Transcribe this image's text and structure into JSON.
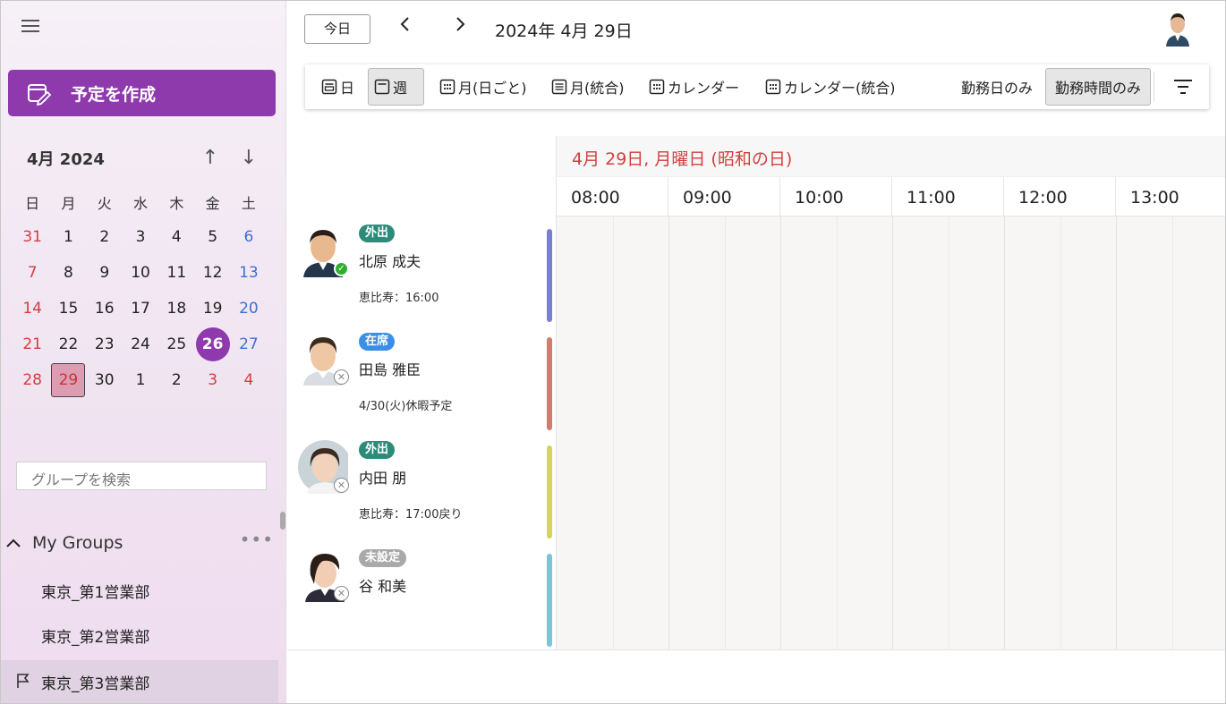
{
  "sidebar": {
    "create_label": "予定を作成",
    "mini_calendar": {
      "month_label": "4月 2024",
      "weekdays": [
        "日",
        "月",
        "火",
        "水",
        "木",
        "金",
        "土"
      ],
      "weeks": [
        [
          "31",
          "1",
          "2",
          "3",
          "4",
          "5",
          "6"
        ],
        [
          "7",
          "8",
          "9",
          "10",
          "11",
          "12",
          "13"
        ],
        [
          "14",
          "15",
          "16",
          "17",
          "18",
          "19",
          "20"
        ],
        [
          "21",
          "22",
          "23",
          "24",
          "25",
          "26",
          "27"
        ],
        [
          "28",
          "29",
          "30",
          "1",
          "2",
          "3",
          "4"
        ]
      ],
      "selected_day": "26",
      "today_day": "29"
    },
    "group_search_placeholder": "グループを検索",
    "my_groups_label": "My Groups",
    "groups": [
      {
        "label": "東京_第1営業部",
        "active": false
      },
      {
        "label": "東京_第2営業部",
        "active": false
      },
      {
        "label": "東京_第3営業部",
        "active": true
      }
    ]
  },
  "header": {
    "today_label": "今日",
    "date_title": "2024年 4月 29日"
  },
  "toolbar": {
    "views": [
      {
        "label": "日",
        "icon": "day-view-icon",
        "active": false
      },
      {
        "label": "週",
        "icon": "week-view-icon",
        "active": true
      },
      {
        "label": "月(日ごと)",
        "icon": "calendar-grid-icon",
        "active": false
      },
      {
        "label": "月(統合)",
        "icon": "list-view-icon",
        "active": false
      },
      {
        "label": "カレンダー",
        "icon": "calendar-grid-icon",
        "active": false
      },
      {
        "label": "カレンダー(統合)",
        "icon": "calendar-grid-icon",
        "active": false
      }
    ],
    "workday_only": "勤務日のみ",
    "worktime_only": "勤務時間のみ"
  },
  "schedule": {
    "date_header": "4月 29日, 月曜日 (昭和の日)",
    "times": [
      "08:00",
      "09:00",
      "10:00",
      "11:00",
      "12:00",
      "13:00"
    ],
    "people": [
      {
        "name": "北原 成夫",
        "status": "外出",
        "status_color": "#2e8b7a",
        "note": "恵比寿：16:00",
        "presence": "available",
        "bar_color": "#7b7fd4"
      },
      {
        "name": "田島 雅臣",
        "status": "在席",
        "status_color": "#3a8ee6",
        "note": "4/30(火)休暇予定",
        "presence": "offline",
        "bar_color": "#d07c6f"
      },
      {
        "name": "内田 朋",
        "status": "外出",
        "status_color": "#2e8b7a",
        "note": "恵比寿：17:00戻り",
        "presence": "offline",
        "bar_color": "#d8d45a"
      },
      {
        "name": "谷 和美",
        "status": "未設定",
        "status_color": "#a9a9a9",
        "note": "",
        "presence": "offline",
        "bar_color": "#7cc4d8"
      }
    ]
  }
}
